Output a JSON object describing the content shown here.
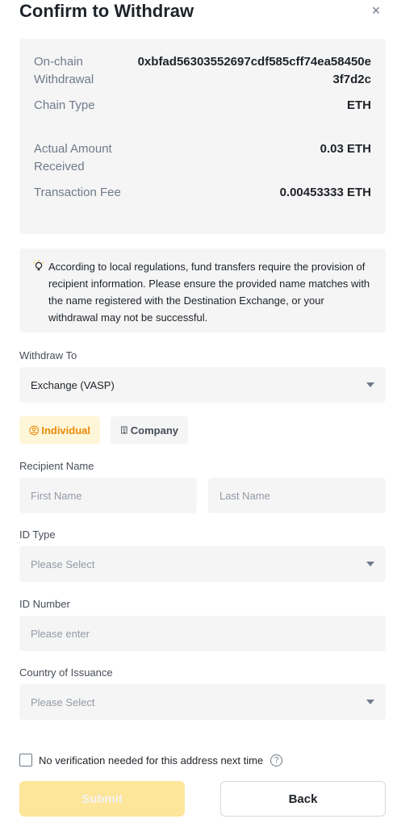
{
  "header": {
    "title": "Confirm to Withdraw",
    "close_label": "×"
  },
  "summary": [
    {
      "label": "On-chain Withdrawal",
      "value": "0xbfad56303552697cdf585cff74ea58450e3f7d2c"
    },
    {
      "label": "Chain Type",
      "value": "ETH"
    },
    {
      "label": "Actual Amount Received",
      "value": "0.03 ETH"
    },
    {
      "label": "Transaction Fee",
      "value": "0.00453333 ETH"
    }
  ],
  "notice": {
    "text": "According to local regulations, fund transfers require the provision of recipient information. Please ensure the provided name matches with the name registered with the Destination Exchange, or your withdrawal may not be successful."
  },
  "withdraw_to": {
    "label": "Withdraw To",
    "value": "Exchange (VASP)"
  },
  "tabs": {
    "individual": "Individual",
    "company": "Company"
  },
  "recipient": {
    "label": "Recipient Name",
    "first_placeholder": "First Name",
    "last_placeholder": "Last Name"
  },
  "id_type": {
    "label": "ID Type",
    "placeholder": "Please Select"
  },
  "id_number": {
    "label": "ID Number",
    "placeholder": "Please enter"
  },
  "country": {
    "label": "Country of Issuance",
    "placeholder": "Please Select"
  },
  "verification": {
    "label": "No verification needed for this address next time",
    "help": "?"
  },
  "buttons": {
    "submit": "Submit",
    "back": "Back"
  },
  "colors": {
    "accent": "#e98a0b",
    "accent_bg": "#fef6d8",
    "submit_disabled": "#fde59a",
    "panel_bg": "#f5f5f5"
  }
}
